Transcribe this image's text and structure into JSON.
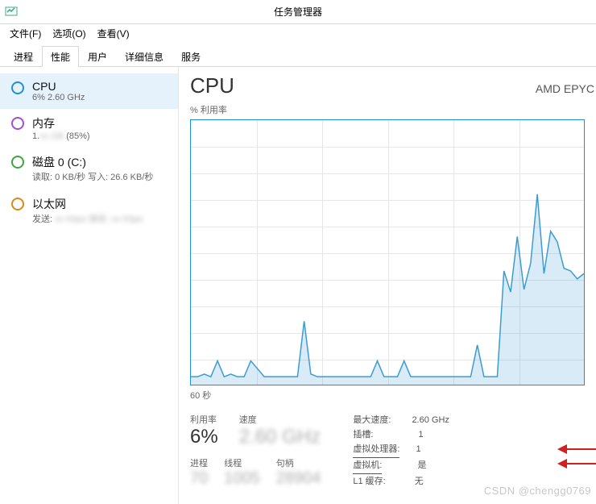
{
  "window": {
    "title": "任务管理器"
  },
  "menu": {
    "file": "文件(F)",
    "options": "选项(O)",
    "view": "查看(V)"
  },
  "tabs": {
    "processes": "进程",
    "performance": "性能",
    "users": "用户",
    "details": "详细信息",
    "services": "服务"
  },
  "sidebar": {
    "cpu": {
      "title": "CPU",
      "sub": "6% 2.60 GHz"
    },
    "memory": {
      "title": "内存",
      "sub_prefix": "1.",
      "sub_suffix": "(85%)"
    },
    "disk": {
      "title": "磁盘 0 (C:)",
      "sub": "读取: 0 KB/秒 写入: 26.6 KB/秒"
    },
    "eth": {
      "title": "以太网",
      "sub_prefix": "发送:"
    }
  },
  "main": {
    "heading": "CPU",
    "brand": "AMD EPYC",
    "y_label": "% 利用率",
    "x_label": "60 秒"
  },
  "chart_data": {
    "type": "area",
    "title": "% 利用率",
    "xlabel": "60 秒",
    "ylabel": "% 利用率",
    "ylim": [
      0,
      100
    ],
    "x": [
      0,
      1,
      2,
      3,
      4,
      5,
      6,
      7,
      8,
      9,
      10,
      11,
      12,
      13,
      14,
      15,
      16,
      17,
      18,
      19,
      20,
      21,
      22,
      23,
      24,
      25,
      26,
      27,
      28,
      29,
      30,
      31,
      32,
      33,
      34,
      35,
      36,
      37,
      38,
      39,
      40,
      41,
      42,
      43,
      44,
      45,
      46,
      47,
      48,
      49,
      50,
      51,
      52,
      53,
      54,
      55,
      56,
      57,
      58,
      59
    ],
    "values": [
      3,
      3,
      4,
      3,
      9,
      3,
      4,
      3,
      3,
      9,
      6,
      3,
      3,
      3,
      3,
      3,
      3,
      24,
      4,
      3,
      3,
      3,
      3,
      3,
      3,
      3,
      3,
      3,
      9,
      3,
      3,
      3,
      9,
      3,
      3,
      3,
      3,
      3,
      3,
      3,
      3,
      3,
      3,
      15,
      3,
      3,
      3,
      43,
      35,
      56,
      36,
      46,
      72,
      42,
      58,
      54,
      44,
      43,
      40,
      42
    ]
  },
  "stats": {
    "util_label": "利用率",
    "util_value": "6%",
    "speed_label": "速度",
    "speed_value": "2.60 GHz",
    "proc_label": "进程",
    "threads_label": "线程",
    "handles_label": "句柄",
    "proc_value": "70",
    "threads_value": "1005",
    "handles_value": "28904",
    "max_speed_label": "最大速度:",
    "max_speed_value": "2.60 GHz",
    "sockets_label": "插槽:",
    "sockets_value": "1",
    "vproc_label": "虚拟处理器:",
    "vproc_value": "1",
    "vm_label": "虚拟机:",
    "vm_value": "是",
    "l1_label": "L1 缓存:",
    "l1_value": "无"
  },
  "watermark": "CSDN @chengg0769"
}
